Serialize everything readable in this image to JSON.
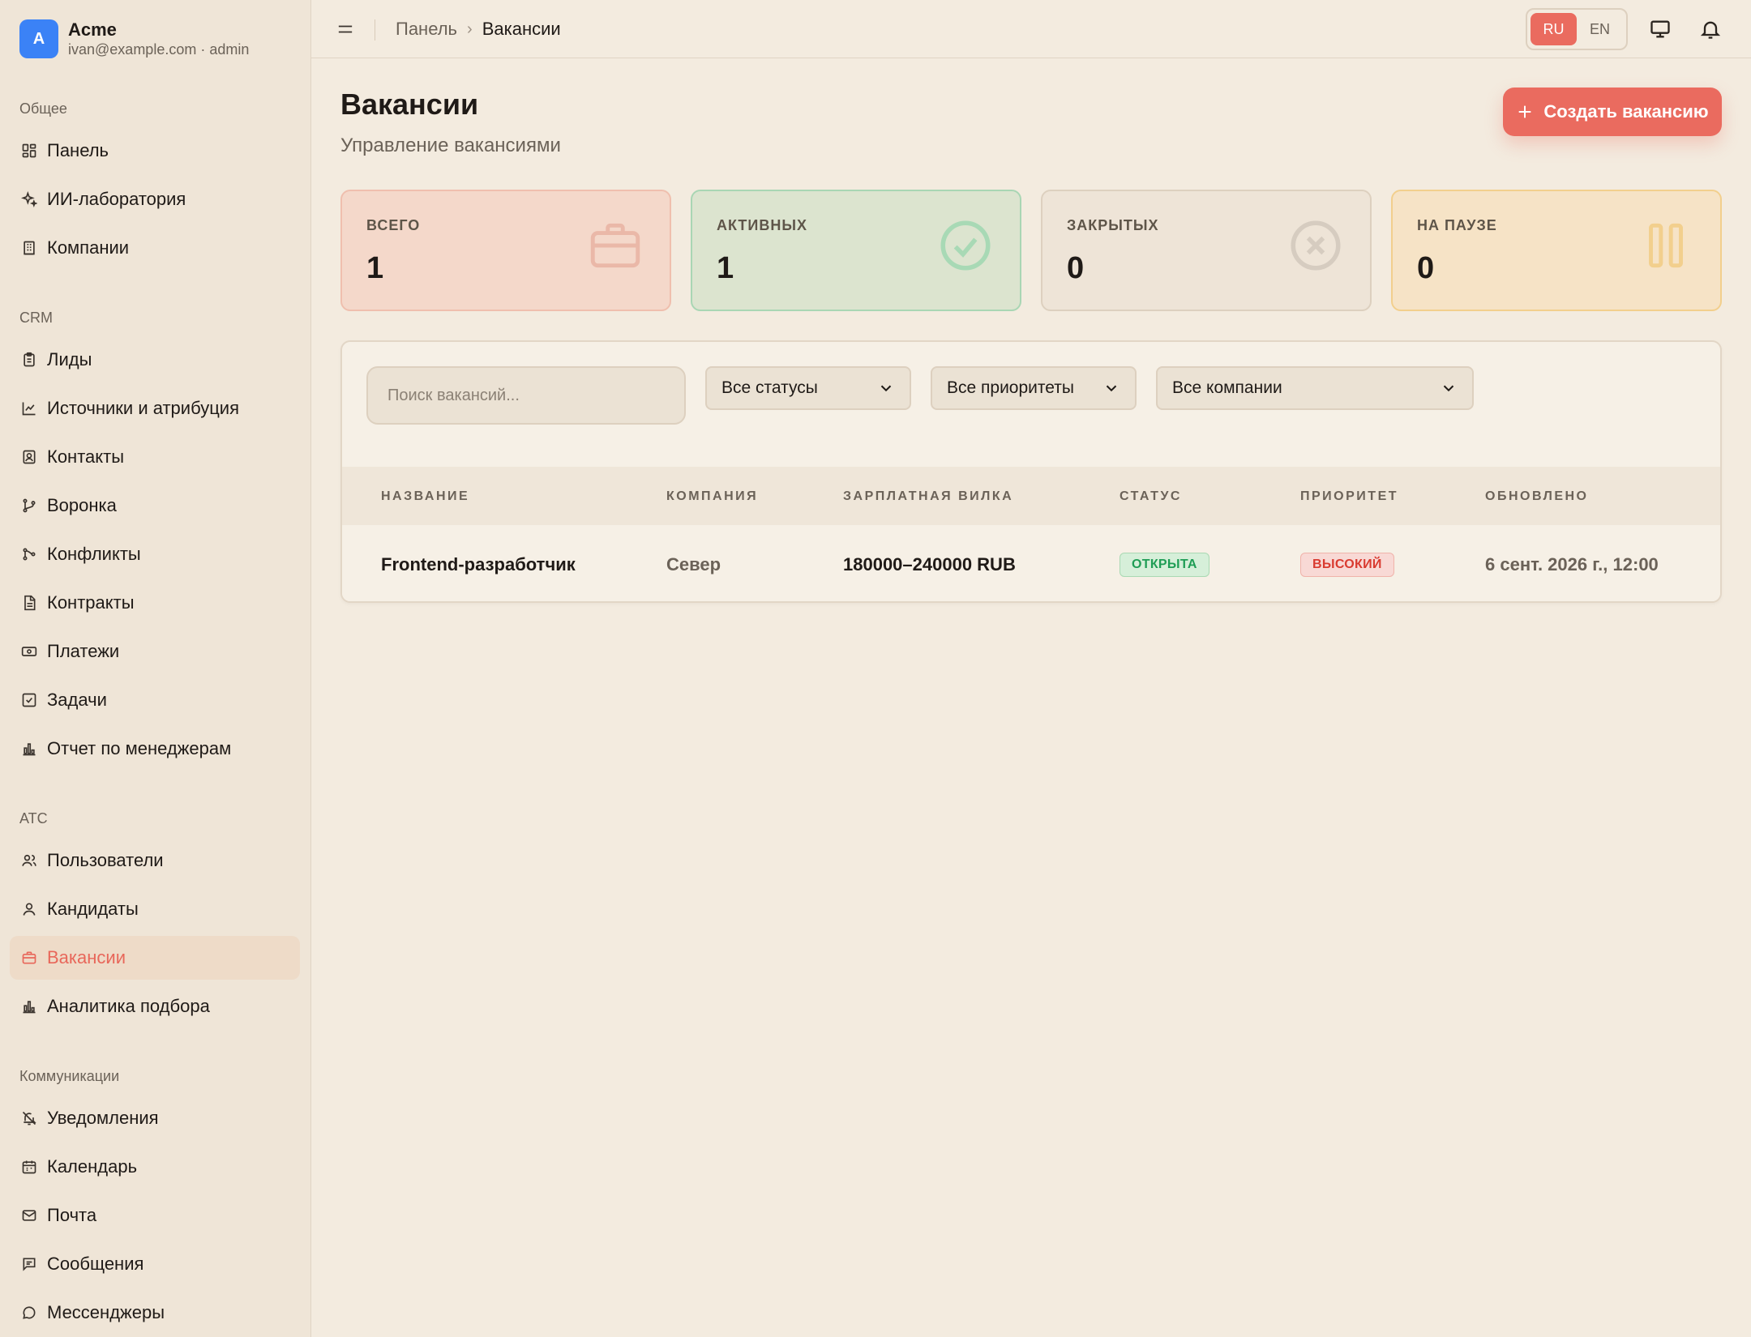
{
  "brand": {
    "initial": "A",
    "name": "Acme",
    "subtitle": "ivan@example.com · admin"
  },
  "nav": {
    "groups": [
      {
        "label": "Общее",
        "items": [
          "Панель",
          "ИИ-лаборатория",
          "Компании"
        ]
      },
      {
        "label": "CRM",
        "items": [
          "Лиды",
          "Источники и атрибуция",
          "Контакты",
          "Воронка",
          "Конфликты",
          "Контракты",
          "Платежи",
          "Задачи",
          "Отчет по менеджерам"
        ]
      },
      {
        "label": "ATC",
        "items": [
          "Пользователи",
          "Кандидаты",
          "Вакансии",
          "Аналитика подбора"
        ]
      },
      {
        "label": "Коммуникации",
        "items": [
          "Уведомления",
          "Календарь",
          "Почта",
          "Сообщения",
          "Мессенджеры"
        ]
      }
    ],
    "active_item": "Вакансии"
  },
  "topbar": {
    "breadcrumb": [
      "Панель",
      "Вакансии"
    ],
    "languages": [
      "RU",
      "EN"
    ],
    "active_language": "RU"
  },
  "page": {
    "title": "Вакансии",
    "subtitle": "Управление вакансиями",
    "create_button": "Создать вакансию"
  },
  "stats": {
    "total": {
      "label": "ВСЕГО",
      "value": "1"
    },
    "active": {
      "label": "АКТИВНЫХ",
      "value": "1"
    },
    "closed": {
      "label": "ЗАКРЫТЫХ",
      "value": "0"
    },
    "paused": {
      "label": "НА ПАУЗЕ",
      "value": "0"
    }
  },
  "filters": {
    "search_placeholder": "Поиск вакансий...",
    "status": "Все статусы",
    "priority": "Все приоритеты",
    "company": "Все компании"
  },
  "table": {
    "columns": [
      "НАЗВАНИЕ",
      "КОМПАНИЯ",
      "ЗАРПЛАТНАЯ ВИЛКА",
      "СТАТУС",
      "ПРИОРИТЕТ",
      "ОБНОВЛЕНО"
    ],
    "rows": [
      {
        "name": "Frontend-разработчик",
        "company": "Север",
        "salary": "180000–240000 RUB",
        "status": "ОТКРЫТА",
        "priority": "ВЫСОКИЙ",
        "updated": "6 сент. 2026 г., 12:00"
      }
    ]
  },
  "colors": {
    "accent": "#ea6b5f",
    "background": "#f3ebdf",
    "sidebar": "#efe5d7",
    "success": "#1f9d55",
    "danger": "#d93b30",
    "brand_avatar": "#3b82f6"
  }
}
